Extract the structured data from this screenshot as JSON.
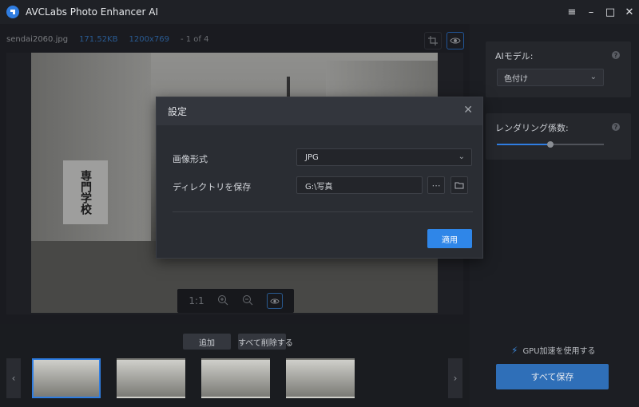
{
  "app": {
    "title": "AVCLabs Photo Enhancer AI"
  },
  "window_controls": [
    "≡",
    "–",
    "□",
    "✕"
  ],
  "image_info": {
    "filename": "sendai2060.jpg",
    "size": "171.52KB",
    "dimensions": "1200x769",
    "position": "- 1 of 4"
  },
  "photo": {
    "sign_text": "専門学校"
  },
  "zoom": {
    "ratio": "1:1"
  },
  "bottom": {
    "add_label": "追加",
    "delete_all_label": "すべて削除する"
  },
  "right_panel": {
    "ai_model_label": "AIモデル:",
    "ai_model_value": "色付け",
    "rendering_label": "レンダリング係数:",
    "rendering_fraction": 0.5,
    "gpu_label": "GPU加速を使用する",
    "save_all_label": "すべて保存"
  },
  "dialog": {
    "title": "設定",
    "format_label": "画像形式",
    "format_value": "JPG",
    "directory_label": "ディレクトリを保存",
    "directory_value": "G:\\写真",
    "apply_label": "適用"
  },
  "colors": {
    "accent": "#2f7de1",
    "background": "#1c1e23",
    "dialog": "#2a2d33"
  }
}
